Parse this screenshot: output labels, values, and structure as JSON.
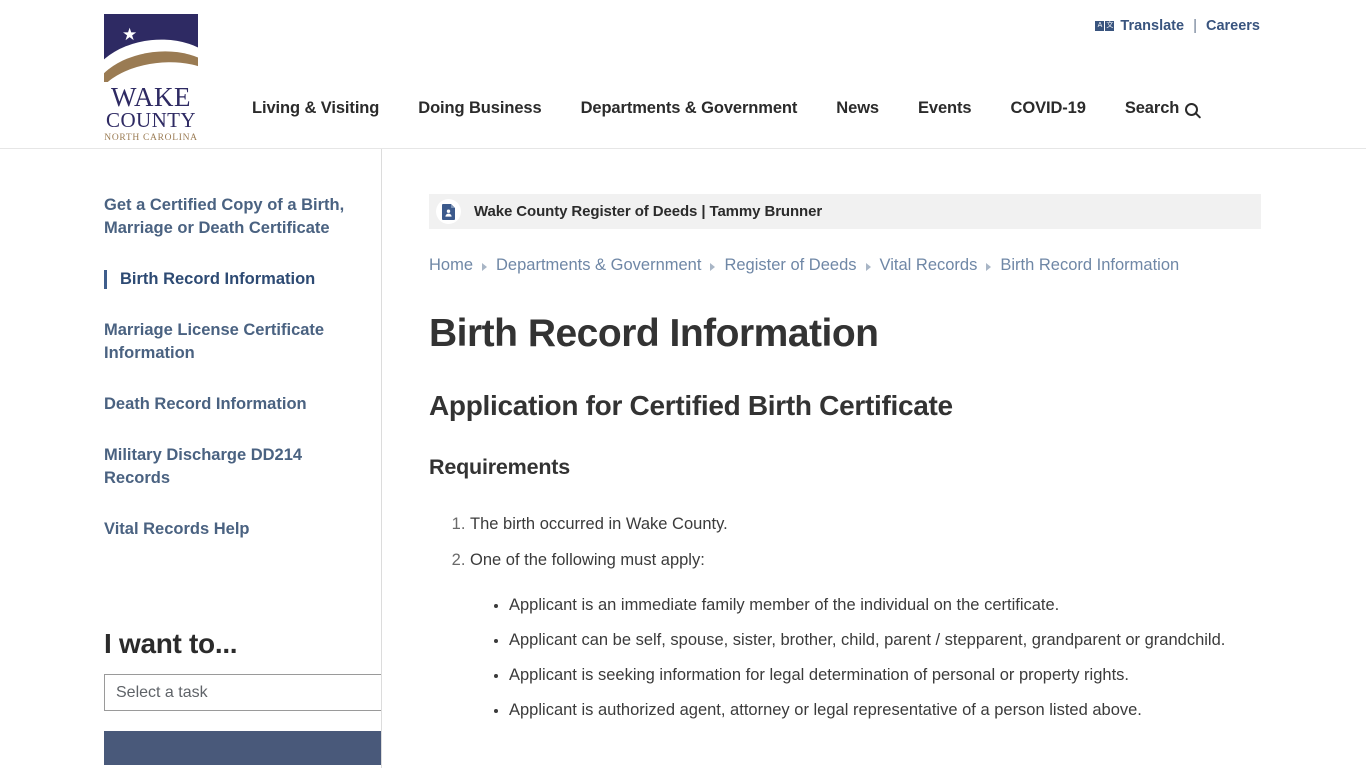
{
  "header": {
    "logo": {
      "line1": "WAKE",
      "line2": "COUNTY",
      "line3": "NORTH CAROLINA",
      "star": "★",
      "navy": "#2e2a63",
      "brown": "#9a7b53"
    },
    "utility": {
      "translate_label": "Translate",
      "translate_icon_a": "A",
      "translate_icon_b": "文",
      "separator": "|",
      "careers_label": "Careers"
    },
    "nav": [
      {
        "label": "Living & Visiting"
      },
      {
        "label": "Doing Business"
      },
      {
        "label": "Departments & Government"
      },
      {
        "label": "News"
      },
      {
        "label": "Events"
      },
      {
        "label": "COVID-19"
      },
      {
        "label": "Search"
      }
    ]
  },
  "sidebar": {
    "items": [
      {
        "label": "Get a Certified Copy of a Birth, Marriage or Death Certificate",
        "active": false
      },
      {
        "label": "Birth Record Information",
        "active": true
      },
      {
        "label": "Marriage License Certificate Information",
        "active": false
      },
      {
        "label": "Death Record Information",
        "active": false
      },
      {
        "label": "Military Discharge DD214 Records",
        "active": false
      },
      {
        "label": "Vital Records Help",
        "active": false
      }
    ],
    "iwant": {
      "title": "I want to...",
      "select_value": "Select a task",
      "button_label": ""
    }
  },
  "content": {
    "department_banner": {
      "title": "Wake County Register of Deeds | Tammy Brunner",
      "icon": "document-person-icon",
      "background": "#f1f1f1"
    },
    "breadcrumb": [
      {
        "label": "Home"
      },
      {
        "label": "Departments & Government"
      },
      {
        "label": "Register of Deeds"
      },
      {
        "label": "Vital Records"
      },
      {
        "label": "Birth Record Information"
      }
    ],
    "page_title": "Birth Record Information",
    "section_title": "Application for Certified Birth Certificate",
    "sub_title": "Requirements",
    "requirements": [
      {
        "text": "The birth occurred in Wake County.",
        "sub": []
      },
      {
        "text": "One of the following must apply:",
        "sub": [
          "Applicant is an immediate family member of the individual on the certificate.",
          "Applicant can be self, spouse, sister, brother, child, parent / stepparent, grandparent or grandchild.",
          "Applicant is seeking information for legal determination of personal or property rights.",
          "Applicant is authorized agent, attorney or legal representative of a person listed above."
        ]
      }
    ]
  },
  "colors": {
    "brand_navy": "#2e2a63",
    "brand_brown": "#9a7b53",
    "link_blue": "#4a6281",
    "active_blue": "#3f5e8c",
    "button_slate": "#49597a"
  }
}
